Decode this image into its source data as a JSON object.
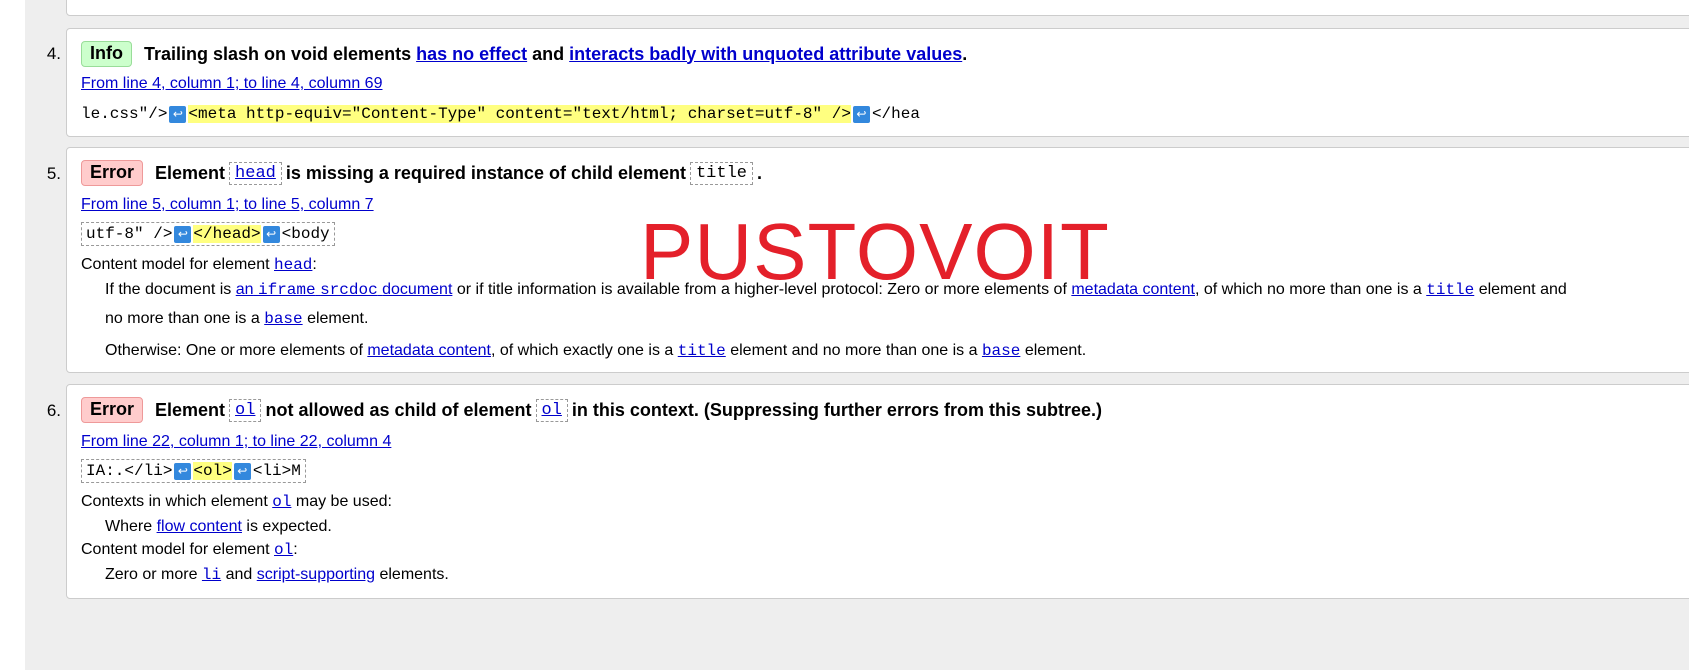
{
  "messages": [
    {
      "number": "4.",
      "badge": "Info",
      "message_parts": {
        "pre": "Trailing slash on void elements",
        "link1": "has no effect",
        "mid": "and",
        "link2": "interacts badly with unquoted attribute values",
        "post": "."
      },
      "location": "From line 4, column 1; to line 4, column 69",
      "extract": {
        "before": "le.css\"/>",
        "highlight": "<meta http-equiv=\"Content-Type\" content=\"text/html; charset=utf-8\" />",
        "after": "</hea"
      }
    },
    {
      "number": "5.",
      "badge": "Error",
      "message_parts": {
        "pre": "Element",
        "code1": "head",
        "mid": "is missing a required instance of child element",
        "code2": "title",
        "post": "."
      },
      "location": "From line 5, column 1; to line 5, column 7",
      "extract": {
        "before": "utf-8\" />",
        "highlight": "</head>",
        "after": "<body"
      },
      "content_model_label": "Content model for element",
      "content_model_element": "head",
      "colon": ":",
      "rule1": {
        "t1": "If the document is",
        "l1a": "an",
        "l1code": "iframe",
        "l1code2": "srcdoc",
        "l1b": "document",
        "t2": "or if title information is available from a higher-level protocol: Zero or more elements of",
        "l2": "metadata content",
        "t3": ", of which no more than one is a",
        "c1": "title",
        "t4": "element and",
        "line2_pre": "no more than one is a",
        "c2": "base",
        "line2_post": "element."
      },
      "rule2": {
        "t1": "Otherwise: One or more elements of",
        "l1": "metadata content",
        "t2": ", of which exactly one is a",
        "c1": "title",
        "t3": "element and no more than one is a",
        "c2": "base",
        "t4": "element."
      }
    },
    {
      "number": "6.",
      "badge": "Error",
      "message_parts": {
        "pre": "Element",
        "code1": "ol",
        "mid": "not allowed as child of element",
        "code2": "ol",
        "post": "in this context. (Suppressing further errors from this subtree.)"
      },
      "location": "From line 22, column 1; to line 22, column 4",
      "extract": {
        "before": "IA:.</li>",
        "highlight": "<ol>",
        "after": "<li>M"
      },
      "contexts_label": "Contexts in which element",
      "contexts_element": "ol",
      "contexts_post": "may be used:",
      "where_pre": "Where",
      "where_link": "flow content",
      "where_post": "is expected.",
      "content_model_label": "Content model for element",
      "content_model_element": "ol",
      "colon": ":",
      "zero_pre": "Zero or more",
      "zero_code": "li",
      "zero_mid": "and",
      "zero_link": "script-supporting",
      "zero_post": "elements."
    }
  ],
  "watermark": "PUSTOVOIT",
  "linefeed_glyph": "↩",
  "colors": {
    "info_badge": "#ccffcc",
    "error_badge": "#ffcccc",
    "highlight": "#ffff80",
    "link": "#0000cc",
    "watermark": "#e4202a"
  }
}
